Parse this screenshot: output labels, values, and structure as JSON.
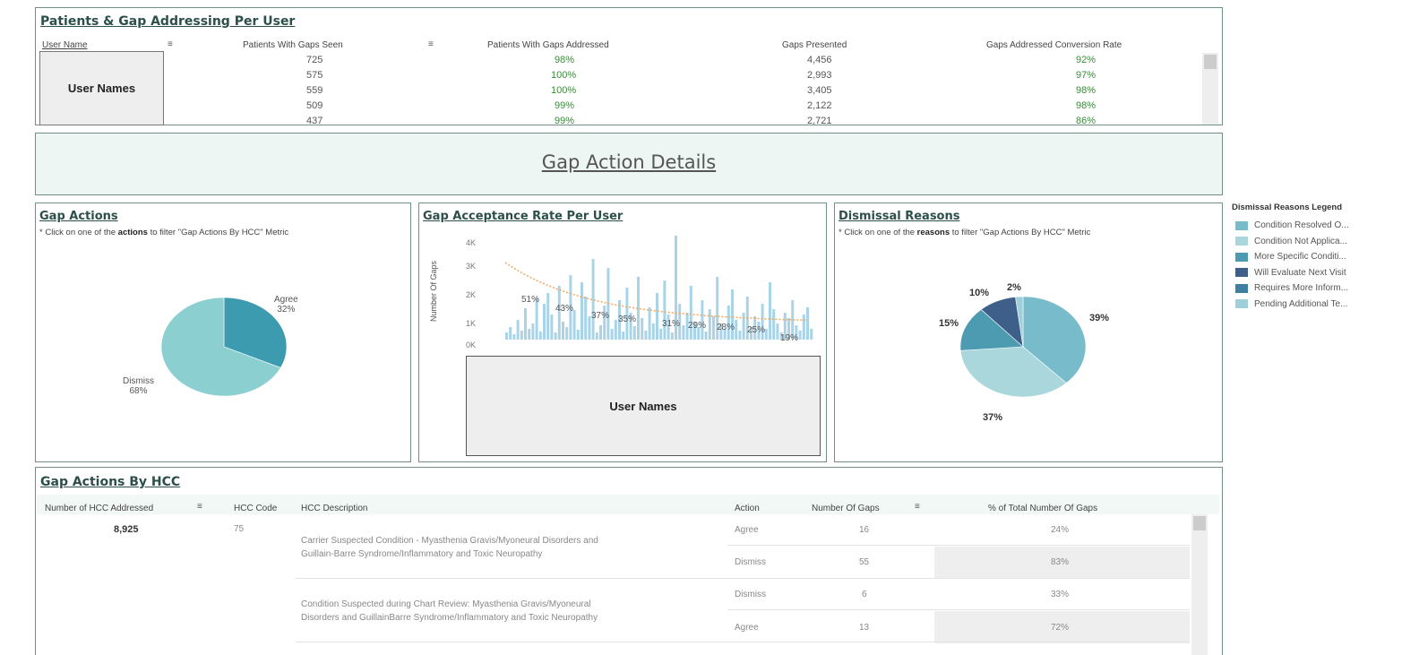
{
  "top_table": {
    "title": "Patients & Gap Addressing Per User",
    "columns": [
      "User Name",
      "Patients With Gaps Seen",
      "Patients With Gaps Addressed",
      "Gaps Presented",
      "Gaps Addressed Conversion Rate"
    ],
    "user_names_placeholder": "User Names",
    "rows": [
      {
        "seen": "725",
        "addressed": "98%",
        "presented": "4,456",
        "rate": "92%"
      },
      {
        "seen": "575",
        "addressed": "100%",
        "presented": "2,993",
        "rate": "97%"
      },
      {
        "seen": "559",
        "addressed": "100%",
        "presented": "3,405",
        "rate": "98%"
      },
      {
        "seen": "509",
        "addressed": "99%",
        "presented": "2,122",
        "rate": "98%"
      },
      {
        "seen": "437",
        "addressed": "99%",
        "presented": "2,721",
        "rate": "86%"
      }
    ]
  },
  "header": {
    "title": "Gap Action Details"
  },
  "gap_actions": {
    "title": "Gap Actions",
    "note_prefix": "* Click on one of the ",
    "note_bold": "actions",
    "note_suffix": " to filter \"Gap Actions By HCC\" Metric",
    "slices": [
      {
        "label": "Agree",
        "pct": "32%",
        "value": 32,
        "color": "#3d9bb0"
      },
      {
        "label": "Dismiss",
        "pct": "68%",
        "value": 68,
        "color": "#8ccfd0"
      }
    ]
  },
  "acceptance": {
    "title": "Gap Acceptance Rate Per User",
    "ylabel": "Number Of Gaps",
    "yticks": [
      "4K",
      "3K",
      "2K",
      "1K",
      "0K"
    ],
    "rate_labels": [
      "51%",
      "43%",
      "37%",
      "35%",
      "31%",
      "29%",
      "28%",
      "25%",
      "19%"
    ],
    "user_names_placeholder": "User Names",
    "bar_color": "#a9d4e8",
    "line_color": "#f0a860"
  },
  "dismissal": {
    "title": "Dismissal Reasons",
    "note_prefix": "* Click on one of the ",
    "note_bold": "reasons",
    "note_suffix": " to filter \"Gap Actions By HCC\" Metric",
    "slices": [
      {
        "pct": "39%",
        "value": 39,
        "color": "#78bccb"
      },
      {
        "pct": "37%",
        "value": 37,
        "color": "#a9d7dc"
      },
      {
        "pct": "15%",
        "value": 15,
        "color": "#4d9bb0"
      },
      {
        "pct": "10%",
        "value": 10,
        "color": "#3d5f8a"
      },
      {
        "pct": "2%",
        "value": 2,
        "color": "#9fd0d9"
      }
    ]
  },
  "legend": {
    "title": "Dismissal Reasons Legend",
    "items": [
      {
        "label": "Condition Resolved O...",
        "color": "#78bccb"
      },
      {
        "label": "Condition Not Applica...",
        "color": "#a9d7dc"
      },
      {
        "label": "More Specific Conditi...",
        "color": "#4d9bb0"
      },
      {
        "label": "Will Evaluate Next Visit",
        "color": "#3d5f8a"
      },
      {
        "label": "Requires More Inform...",
        "color": "#3f7fa1"
      },
      {
        "label": "Pending Additional Te...",
        "color": "#9fd0d9"
      }
    ]
  },
  "hcc": {
    "title": "Gap Actions By HCC",
    "columns": [
      "Number of HCC Addressed",
      "HCC Code",
      "HCC Description",
      "Action",
      "Number Of Gaps",
      "% of Total Number Of Gaps"
    ],
    "total": "8,925",
    "code": "75",
    "groups": [
      {
        "description_1": "Carrier Suspected Condition - Myasthenia Gravis/Myoneural Disorders and",
        "description_2": "Guillain-Barre Syndrome/Inflammatory and Toxic Neuropathy",
        "rows": [
          {
            "action": "Agree",
            "gaps": "16",
            "pct": "24%"
          },
          {
            "action": "Dismiss",
            "gaps": "55",
            "pct": "83%"
          }
        ]
      },
      {
        "description_1": "Condition Suspected during Chart Review: Myasthenia Gravis/Myoneural",
        "description_2": "Disorders and GuillainBarre Syndrome/Inflammatory and Toxic Neuropathy",
        "rows": [
          {
            "action": "Dismiss",
            "gaps": "6",
            "pct": "33%"
          },
          {
            "action": "Agree",
            "gaps": "13",
            "pct": "72%"
          }
        ]
      }
    ]
  }
}
